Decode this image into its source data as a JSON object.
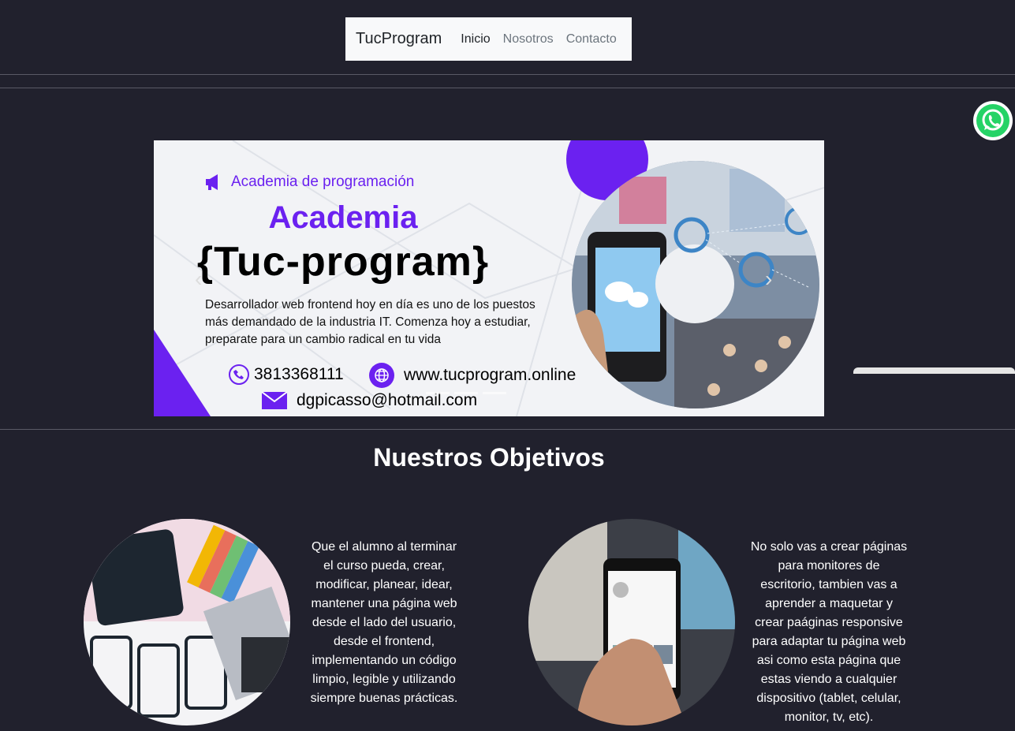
{
  "nav": {
    "brand": "TucProgram",
    "links": [
      "Inicio",
      "Nosotros",
      "Contacto"
    ]
  },
  "banner": {
    "kicker": "Academia de programación",
    "title": "Academia",
    "brand": "{Tuc-program}",
    "description": "Desarrollador web frontend hoy en día es uno de los puestos más demandado de la industria IT. Comenza hoy a estudiar, preparate para un cambio radical en tu vida",
    "phone": "3813368111",
    "website": "www.tucprogram.online",
    "email": "dgpicasso@hotmail.com"
  },
  "objectives": {
    "title": "Nuestros Objetivos",
    "items": [
      "Que el alumno al terminar el curso pueda, crear, modificar, planear, idear, mantener una página web desde el lado del usuario, desde el frontend, implementando un código limpio, legible y utilizando siempre buenas prácticas.",
      "No solo vas a crear páginas para monitores de escritorio, tambien vas a aprender a maquetar y crear paáginas responsive para adaptar tu página web asi como esta página que estas viendo a cualquier dispositivo (tablet, celular, monitor, tv, etc)."
    ]
  },
  "colors": {
    "background": "#21212d",
    "accent": "#6b21f0",
    "navbar": "#f8f9fa",
    "whatsapp": "#25d366"
  },
  "icons": [
    "whatsapp-icon",
    "megaphone-icon",
    "phone-icon",
    "globe-icon",
    "mail-icon",
    "chevron-left-icon",
    "chevron-right-icon"
  ]
}
